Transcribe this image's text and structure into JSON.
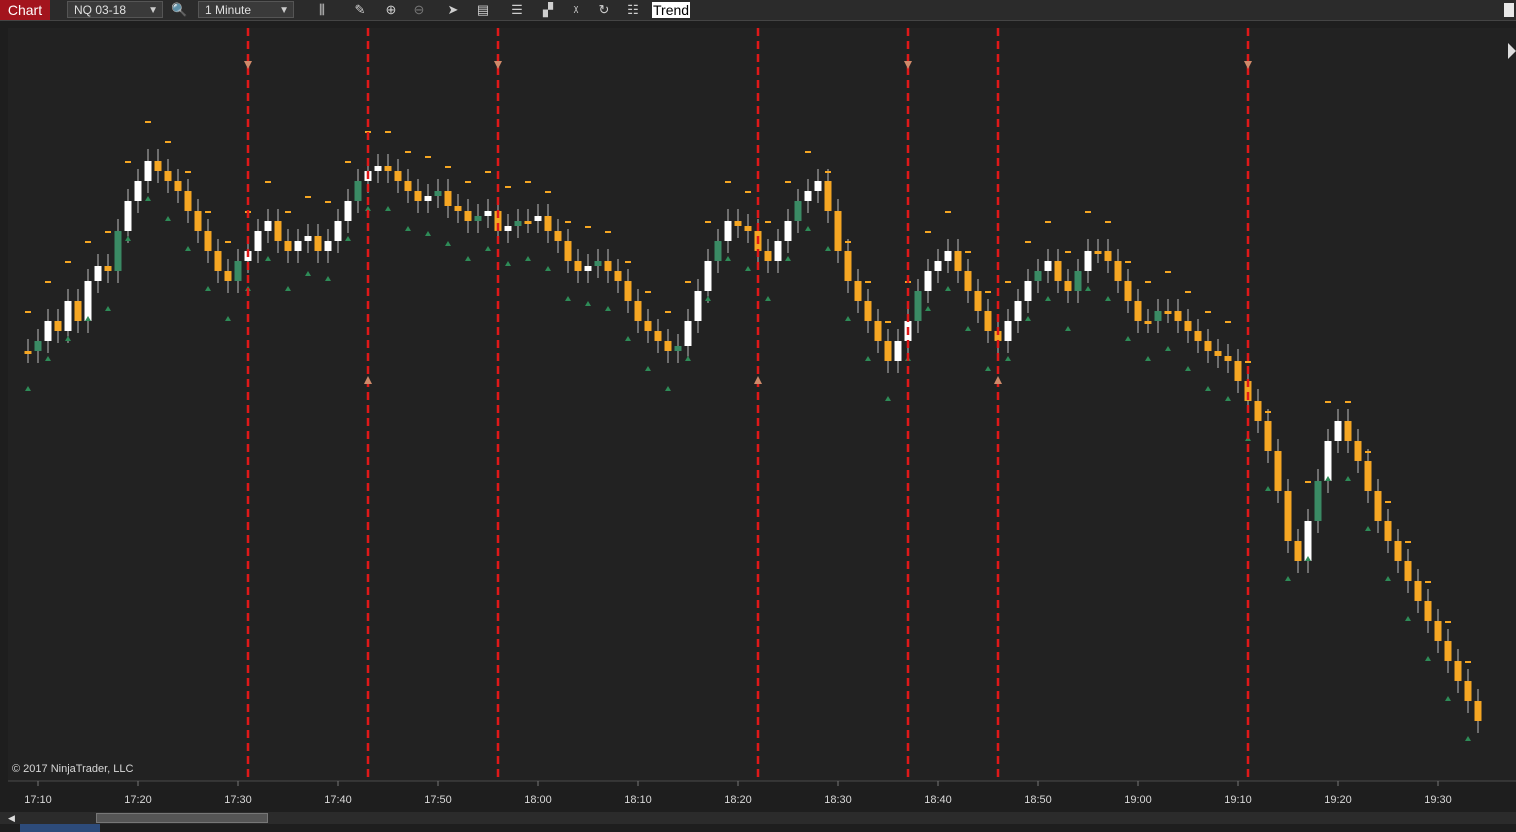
{
  "toolbar": {
    "tab_label": "Chart",
    "instrument": "NQ 03-18",
    "interval": "1 Minute",
    "trend_label": "Trend",
    "icons": [
      "search-icon",
      "bar-type-icon",
      "pencil-icon",
      "zoom-in-icon",
      "zoom-out-icon",
      "pointer-icon",
      "data-box-icon",
      "chart-trader-icon",
      "strategies-icon",
      "indicators-icon",
      "refresh-icon",
      "properties-icon"
    ]
  },
  "chart": {
    "copyright": "© 2017 NinjaTrader, LLC",
    "x_tick_labels": [
      "17:10",
      "17:20",
      "17:30",
      "17:40",
      "17:50",
      "18:00",
      "18:10",
      "18:20",
      "18:30",
      "18:40",
      "18:50",
      "19:00",
      "19:10",
      "19:20",
      "19:30"
    ],
    "colors": {
      "background": "#1e1e1e",
      "up_candle": "#ffffff",
      "down_candle": "#f5a623",
      "green_candle": "#3a8a64",
      "trend_line": "#e01818",
      "sell_marker": "#f5a623",
      "buy_marker": "#2e8b57"
    },
    "signal_lines": [
      {
        "time": "17:31",
        "dir": "down"
      },
      {
        "time": "17:43",
        "dir": "up"
      },
      {
        "time": "17:56",
        "dir": "down"
      },
      {
        "time": "18:22",
        "dir": "up"
      },
      {
        "time": "18:37",
        "dir": "down"
      },
      {
        "time": "18:46",
        "dir": "up"
      },
      {
        "time": "19:11",
        "dir": "down"
      }
    ]
  }
}
